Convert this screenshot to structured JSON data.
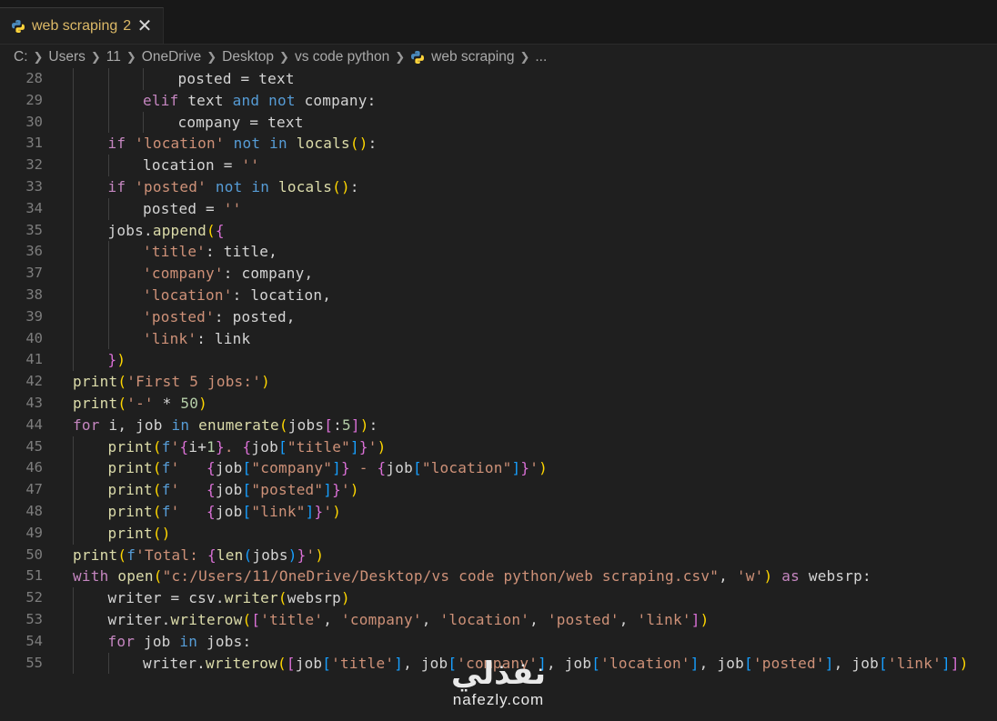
{
  "tab": {
    "title": "web scraping",
    "problem_count": "2",
    "icon": "python-icon",
    "close": "✕"
  },
  "breadcrumb": [
    "C:",
    "Users",
    "11",
    "OneDrive",
    "Desktop",
    "vs code python",
    "web scraping",
    "..."
  ],
  "colors": {
    "keyword": "#c586c0",
    "keyword_blue": "#569cd6",
    "function": "#dcdcaa",
    "string": "#ce9178",
    "text": "#d4d4d4",
    "number": "#b5cea8",
    "bracket1": "#ffd700",
    "bracket2": "#da70d6",
    "bracket3": "#179fff",
    "line_number": "#7d7d7d",
    "tab_title": "#dcb967",
    "background": "#1f1f1f"
  },
  "lines": [
    {
      "n": "28",
      "indent": 3,
      "t": [
        [
          "posted = text",
          "var"
        ]
      ]
    },
    {
      "n": "29",
      "indent": 2,
      "t": [
        [
          "elif",
          "kw"
        ],
        [
          " text ",
          "var"
        ],
        [
          "and",
          "blue"
        ],
        [
          " ",
          "var"
        ],
        [
          "not",
          "blue"
        ],
        [
          " company:",
          "var"
        ]
      ]
    },
    {
      "n": "30",
      "indent": 3,
      "t": [
        [
          "company = text",
          "var"
        ]
      ]
    },
    {
      "n": "31",
      "indent": 1,
      "t": [
        [
          "if",
          "kw"
        ],
        [
          " ",
          "var"
        ],
        [
          "'location'",
          "str"
        ],
        [
          " ",
          "var"
        ],
        [
          "not",
          "blue"
        ],
        [
          " ",
          "var"
        ],
        [
          "in",
          "blue"
        ],
        [
          " ",
          "var"
        ],
        [
          "locals",
          "fn"
        ],
        [
          "()",
          "b1"
        ],
        [
          ":",
          "var"
        ]
      ]
    },
    {
      "n": "32",
      "indent": 2,
      "t": [
        [
          "location = ",
          "var"
        ],
        [
          "''",
          "str"
        ]
      ]
    },
    {
      "n": "33",
      "indent": 1,
      "t": [
        [
          "if",
          "kw"
        ],
        [
          " ",
          "var"
        ],
        [
          "'posted'",
          "str"
        ],
        [
          " ",
          "var"
        ],
        [
          "not",
          "blue"
        ],
        [
          " ",
          "var"
        ],
        [
          "in",
          "blue"
        ],
        [
          " ",
          "var"
        ],
        [
          "locals",
          "fn"
        ],
        [
          "()",
          "b1"
        ],
        [
          ":",
          "var"
        ]
      ]
    },
    {
      "n": "34",
      "indent": 2,
      "t": [
        [
          "posted = ",
          "var"
        ],
        [
          "''",
          "str"
        ]
      ]
    },
    {
      "n": "35",
      "indent": 1,
      "t": [
        [
          "jobs.",
          "var"
        ],
        [
          "append",
          "fn"
        ],
        [
          "(",
          "b1"
        ],
        [
          "{",
          "b2"
        ]
      ]
    },
    {
      "n": "36",
      "indent": 2,
      "t": [
        [
          "'title'",
          "str"
        ],
        [
          ": title,",
          "var"
        ]
      ]
    },
    {
      "n": "37",
      "indent": 2,
      "t": [
        [
          "'company'",
          "str"
        ],
        [
          ": company,",
          "var"
        ]
      ]
    },
    {
      "n": "38",
      "indent": 2,
      "t": [
        [
          "'location'",
          "str"
        ],
        [
          ": location,",
          "var"
        ]
      ]
    },
    {
      "n": "39",
      "indent": 2,
      "t": [
        [
          "'posted'",
          "str"
        ],
        [
          ": posted,",
          "var"
        ]
      ]
    },
    {
      "n": "40",
      "indent": 2,
      "t": [
        [
          "'link'",
          "str"
        ],
        [
          ": link",
          "var"
        ]
      ]
    },
    {
      "n": "41",
      "indent": 1,
      "t": [
        [
          "}",
          "b2"
        ],
        [
          ")",
          "b1"
        ]
      ]
    },
    {
      "n": "42",
      "indent": 0,
      "t": [
        [
          "print",
          "fn"
        ],
        [
          "(",
          "b1"
        ],
        [
          "'First 5 jobs:'",
          "str"
        ],
        [
          ")",
          "b1"
        ]
      ]
    },
    {
      "n": "43",
      "indent": 0,
      "t": [
        [
          "print",
          "fn"
        ],
        [
          "(",
          "b1"
        ],
        [
          "'-'",
          "str"
        ],
        [
          " * ",
          "var"
        ],
        [
          "50",
          "num"
        ],
        [
          ")",
          "b1"
        ]
      ]
    },
    {
      "n": "44",
      "indent": 0,
      "t": [
        [
          "for",
          "kw"
        ],
        [
          " i, job ",
          "var"
        ],
        [
          "in",
          "blue"
        ],
        [
          " ",
          "var"
        ],
        [
          "enumerate",
          "fn"
        ],
        [
          "(",
          "b1"
        ],
        [
          "jobs",
          "var"
        ],
        [
          "[",
          "b2"
        ],
        [
          ":",
          "var"
        ],
        [
          "5",
          "num"
        ],
        [
          "]",
          "b2"
        ],
        [
          ")",
          "b1"
        ],
        [
          ":",
          "var"
        ]
      ]
    },
    {
      "n": "45",
      "indent": 1,
      "t": [
        [
          "print",
          "fn"
        ],
        [
          "(",
          "b1"
        ],
        [
          "f",
          "blue"
        ],
        [
          "'",
          "str"
        ],
        [
          "{",
          "b2"
        ],
        [
          "i+",
          "var"
        ],
        [
          "1",
          "num"
        ],
        [
          "}",
          "b2"
        ],
        [
          ". ",
          "str"
        ],
        [
          "{",
          "b2"
        ],
        [
          "job",
          "var"
        ],
        [
          "[",
          "b3"
        ],
        [
          "\"title\"",
          "str"
        ],
        [
          "]",
          "b3"
        ],
        [
          "}",
          "b2"
        ],
        [
          "'",
          "str"
        ],
        [
          ")",
          "b1"
        ]
      ]
    },
    {
      "n": "46",
      "indent": 1,
      "t": [
        [
          "print",
          "fn"
        ],
        [
          "(",
          "b1"
        ],
        [
          "f",
          "blue"
        ],
        [
          "'   ",
          "str"
        ],
        [
          "{",
          "b2"
        ],
        [
          "job",
          "var"
        ],
        [
          "[",
          "b3"
        ],
        [
          "\"company\"",
          "str"
        ],
        [
          "]",
          "b3"
        ],
        [
          "}",
          "b2"
        ],
        [
          " - ",
          "str"
        ],
        [
          "{",
          "b2"
        ],
        [
          "job",
          "var"
        ],
        [
          "[",
          "b3"
        ],
        [
          "\"location\"",
          "str"
        ],
        [
          "]",
          "b3"
        ],
        [
          "}",
          "b2"
        ],
        [
          "'",
          "str"
        ],
        [
          ")",
          "b1"
        ]
      ]
    },
    {
      "n": "47",
      "indent": 1,
      "t": [
        [
          "print",
          "fn"
        ],
        [
          "(",
          "b1"
        ],
        [
          "f",
          "blue"
        ],
        [
          "'   ",
          "str"
        ],
        [
          "{",
          "b2"
        ],
        [
          "job",
          "var"
        ],
        [
          "[",
          "b3"
        ],
        [
          "\"posted\"",
          "str"
        ],
        [
          "]",
          "b3"
        ],
        [
          "}",
          "b2"
        ],
        [
          "'",
          "str"
        ],
        [
          ")",
          "b1"
        ]
      ]
    },
    {
      "n": "48",
      "indent": 1,
      "t": [
        [
          "print",
          "fn"
        ],
        [
          "(",
          "b1"
        ],
        [
          "f",
          "blue"
        ],
        [
          "'   ",
          "str"
        ],
        [
          "{",
          "b2"
        ],
        [
          "job",
          "var"
        ],
        [
          "[",
          "b3"
        ],
        [
          "\"link\"",
          "str"
        ],
        [
          "]",
          "b3"
        ],
        [
          "}",
          "b2"
        ],
        [
          "'",
          "str"
        ],
        [
          ")",
          "b1"
        ]
      ]
    },
    {
      "n": "49",
      "indent": 1,
      "t": [
        [
          "print",
          "fn"
        ],
        [
          "()",
          "b1"
        ]
      ]
    },
    {
      "n": "50",
      "indent": 0,
      "t": [
        [
          "print",
          "fn"
        ],
        [
          "(",
          "b1"
        ],
        [
          "f",
          "blue"
        ],
        [
          "'Total: ",
          "str"
        ],
        [
          "{",
          "b2"
        ],
        [
          "len",
          "fn"
        ],
        [
          "(",
          "b3"
        ],
        [
          "jobs",
          "var"
        ],
        [
          ")",
          "b3"
        ],
        [
          "}",
          "b2"
        ],
        [
          "'",
          "str"
        ],
        [
          ")",
          "b1"
        ]
      ]
    },
    {
      "n": "51",
      "indent": 0,
      "t": [
        [
          "with",
          "kw"
        ],
        [
          " ",
          "var"
        ],
        [
          "open",
          "fn"
        ],
        [
          "(",
          "b1"
        ],
        [
          "\"c:/Users/11/OneDrive/Desktop/vs code python/web scraping.csv\"",
          "str"
        ],
        [
          ", ",
          "var"
        ],
        [
          "'w'",
          "str"
        ],
        [
          ")",
          "b1"
        ],
        [
          " ",
          "var"
        ],
        [
          "as",
          "kw"
        ],
        [
          " websrp:",
          "var"
        ]
      ]
    },
    {
      "n": "52",
      "indent": 1,
      "t": [
        [
          "writer = ",
          "var"
        ],
        [
          "csv",
          "var"
        ],
        [
          ".",
          "var"
        ],
        [
          "writer",
          "fn"
        ],
        [
          "(",
          "b1"
        ],
        [
          "websrp",
          "var"
        ],
        [
          ")",
          "b1"
        ]
      ]
    },
    {
      "n": "53",
      "indent": 1,
      "t": [
        [
          "writer.",
          "var"
        ],
        [
          "writerow",
          "fn"
        ],
        [
          "(",
          "b1"
        ],
        [
          "[",
          "b2"
        ],
        [
          "'title'",
          "str"
        ],
        [
          ", ",
          "var"
        ],
        [
          "'company'",
          "str"
        ],
        [
          ", ",
          "var"
        ],
        [
          "'location'",
          "str"
        ],
        [
          ", ",
          "var"
        ],
        [
          "'posted'",
          "str"
        ],
        [
          ", ",
          "var"
        ],
        [
          "'link'",
          "str"
        ],
        [
          "]",
          "b2"
        ],
        [
          ")",
          "b1"
        ]
      ]
    },
    {
      "n": "54",
      "indent": 1,
      "t": [
        [
          "for",
          "kw"
        ],
        [
          " job ",
          "var"
        ],
        [
          "in",
          "blue"
        ],
        [
          " jobs:",
          "var"
        ]
      ]
    },
    {
      "n": "55",
      "indent": 2,
      "t": [
        [
          "writer.",
          "var"
        ],
        [
          "writerow",
          "fn"
        ],
        [
          "(",
          "b1"
        ],
        [
          "[",
          "b2"
        ],
        [
          "job",
          "var"
        ],
        [
          "[",
          "b3"
        ],
        [
          "'title'",
          "str"
        ],
        [
          "]",
          "b3"
        ],
        [
          ", job",
          "var"
        ],
        [
          "[",
          "b3"
        ],
        [
          "'company'",
          "str"
        ],
        [
          "]",
          "b3"
        ],
        [
          ", job",
          "var"
        ],
        [
          "[",
          "b3"
        ],
        [
          "'location'",
          "str"
        ],
        [
          "]",
          "b3"
        ],
        [
          ", job",
          "var"
        ],
        [
          "[",
          "b3"
        ],
        [
          "'posted'",
          "str"
        ],
        [
          "]",
          "b3"
        ],
        [
          ", job",
          "var"
        ],
        [
          "[",
          "b3"
        ],
        [
          "'link'",
          "str"
        ],
        [
          "]",
          "b3"
        ],
        [
          "]",
          "b2"
        ],
        [
          ")",
          "b1"
        ]
      ]
    }
  ],
  "watermark": {
    "arabic": "نفذلي",
    "latin": "nafezly.com"
  }
}
